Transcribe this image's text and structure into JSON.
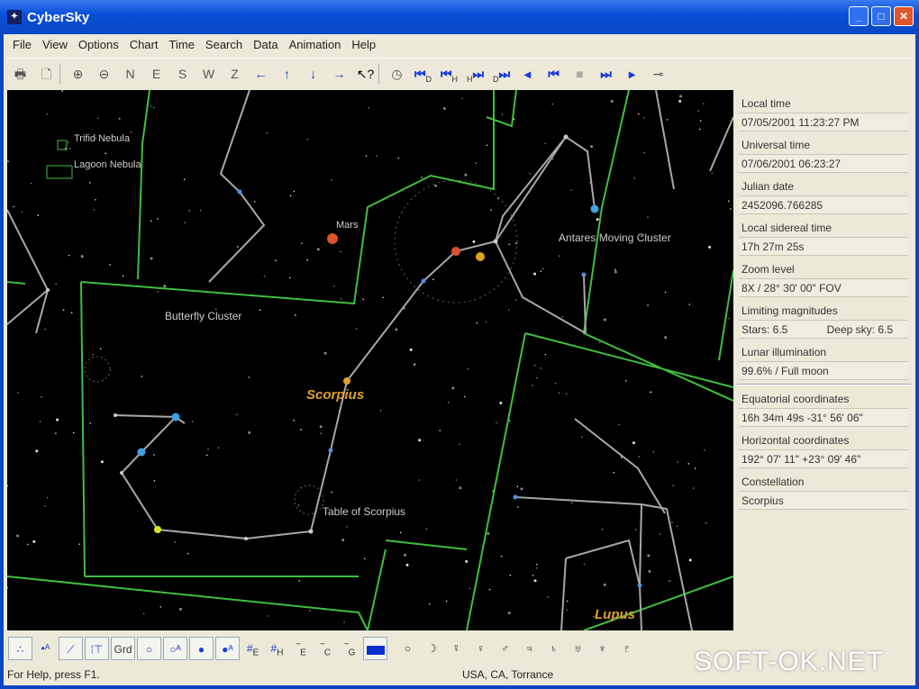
{
  "window": {
    "title": "CyberSky"
  },
  "menu": [
    "File",
    "View",
    "Options",
    "Chart",
    "Time",
    "Search",
    "Data",
    "Animation",
    "Help"
  ],
  "toolbar": {
    "compass": [
      "N",
      "E",
      "S",
      "W",
      "Z"
    ]
  },
  "map": {
    "labels": {
      "trifid": "Trifid Nebula",
      "lagoon": "Lagoon Nebula",
      "mars": "Mars",
      "antares": "Antares Moving Cluster",
      "butterfly": "Butterfly Cluster",
      "scorpius": "Scorpius",
      "table": "Table of Scorpius",
      "lupus": "Lupus"
    },
    "colors": {
      "background": "#000000",
      "constellation_lines": "#b0b0b0",
      "boundaries": "#3fbf3f",
      "constellation_names": "#e0a030"
    }
  },
  "side_panel": {
    "fields": [
      {
        "label": "Local time",
        "value": "07/05/2001 11:23:27 PM"
      },
      {
        "label": "Universal time",
        "value": "07/06/2001 06:23:27"
      },
      {
        "label": "Julian date",
        "value": "2452096.766285"
      },
      {
        "label": "Local sidereal time",
        "value": "17h 27m 25s"
      },
      {
        "label": "Zoom level",
        "value": "8X / 28° 30' 00\" FOV"
      },
      {
        "label": "Limiting magnitudes",
        "value": "Stars: 6.5",
        "value2": "Deep sky: 6.5"
      },
      {
        "label": "Lunar illumination",
        "value": "99.6% / Full moon"
      },
      {
        "label": "Equatorial coordinates",
        "value": "16h 34m 49s -31° 56' 06\""
      },
      {
        "label": "Horizontal coordinates",
        "value": "192° 07' 11\" +23° 09' 46\""
      },
      {
        "label": "Constellation",
        "value": "Scorpius"
      }
    ]
  },
  "bottom_toolbar": {
    "grid_label": "Grd",
    "labels": [
      "E",
      "H",
      "E",
      "C",
      "G"
    ]
  },
  "status": {
    "help": "For Help, press F1.",
    "location": "USA, CA, Torrance"
  },
  "watermark": "SOFT-OK.NET"
}
